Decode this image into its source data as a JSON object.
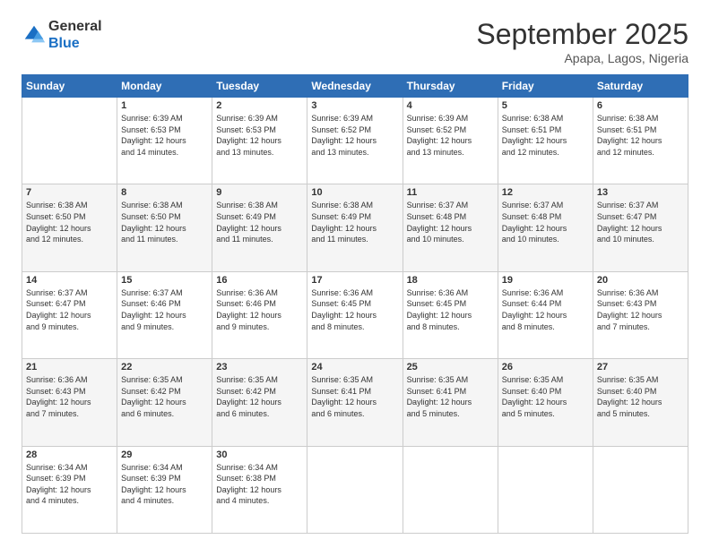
{
  "header": {
    "logo_general": "General",
    "logo_blue": "Blue",
    "month": "September 2025",
    "location": "Apapa, Lagos, Nigeria"
  },
  "days_of_week": [
    "Sunday",
    "Monday",
    "Tuesday",
    "Wednesday",
    "Thursday",
    "Friday",
    "Saturday"
  ],
  "weeks": [
    [
      {
        "day": "",
        "info": ""
      },
      {
        "day": "1",
        "info": "Sunrise: 6:39 AM\nSunset: 6:53 PM\nDaylight: 12 hours\nand 14 minutes."
      },
      {
        "day": "2",
        "info": "Sunrise: 6:39 AM\nSunset: 6:53 PM\nDaylight: 12 hours\nand 13 minutes."
      },
      {
        "day": "3",
        "info": "Sunrise: 6:39 AM\nSunset: 6:52 PM\nDaylight: 12 hours\nand 13 minutes."
      },
      {
        "day": "4",
        "info": "Sunrise: 6:39 AM\nSunset: 6:52 PM\nDaylight: 12 hours\nand 13 minutes."
      },
      {
        "day": "5",
        "info": "Sunrise: 6:38 AM\nSunset: 6:51 PM\nDaylight: 12 hours\nand 12 minutes."
      },
      {
        "day": "6",
        "info": "Sunrise: 6:38 AM\nSunset: 6:51 PM\nDaylight: 12 hours\nand 12 minutes."
      }
    ],
    [
      {
        "day": "7",
        "info": "Sunrise: 6:38 AM\nSunset: 6:50 PM\nDaylight: 12 hours\nand 12 minutes."
      },
      {
        "day": "8",
        "info": "Sunrise: 6:38 AM\nSunset: 6:50 PM\nDaylight: 12 hours\nand 11 minutes."
      },
      {
        "day": "9",
        "info": "Sunrise: 6:38 AM\nSunset: 6:49 PM\nDaylight: 12 hours\nand 11 minutes."
      },
      {
        "day": "10",
        "info": "Sunrise: 6:38 AM\nSunset: 6:49 PM\nDaylight: 12 hours\nand 11 minutes."
      },
      {
        "day": "11",
        "info": "Sunrise: 6:37 AM\nSunset: 6:48 PM\nDaylight: 12 hours\nand 10 minutes."
      },
      {
        "day": "12",
        "info": "Sunrise: 6:37 AM\nSunset: 6:48 PM\nDaylight: 12 hours\nand 10 minutes."
      },
      {
        "day": "13",
        "info": "Sunrise: 6:37 AM\nSunset: 6:47 PM\nDaylight: 12 hours\nand 10 minutes."
      }
    ],
    [
      {
        "day": "14",
        "info": "Sunrise: 6:37 AM\nSunset: 6:47 PM\nDaylight: 12 hours\nand 9 minutes."
      },
      {
        "day": "15",
        "info": "Sunrise: 6:37 AM\nSunset: 6:46 PM\nDaylight: 12 hours\nand 9 minutes."
      },
      {
        "day": "16",
        "info": "Sunrise: 6:36 AM\nSunset: 6:46 PM\nDaylight: 12 hours\nand 9 minutes."
      },
      {
        "day": "17",
        "info": "Sunrise: 6:36 AM\nSunset: 6:45 PM\nDaylight: 12 hours\nand 8 minutes."
      },
      {
        "day": "18",
        "info": "Sunrise: 6:36 AM\nSunset: 6:45 PM\nDaylight: 12 hours\nand 8 minutes."
      },
      {
        "day": "19",
        "info": "Sunrise: 6:36 AM\nSunset: 6:44 PM\nDaylight: 12 hours\nand 8 minutes."
      },
      {
        "day": "20",
        "info": "Sunrise: 6:36 AM\nSunset: 6:43 PM\nDaylight: 12 hours\nand 7 minutes."
      }
    ],
    [
      {
        "day": "21",
        "info": "Sunrise: 6:36 AM\nSunset: 6:43 PM\nDaylight: 12 hours\nand 7 minutes."
      },
      {
        "day": "22",
        "info": "Sunrise: 6:35 AM\nSunset: 6:42 PM\nDaylight: 12 hours\nand 6 minutes."
      },
      {
        "day": "23",
        "info": "Sunrise: 6:35 AM\nSunset: 6:42 PM\nDaylight: 12 hours\nand 6 minutes."
      },
      {
        "day": "24",
        "info": "Sunrise: 6:35 AM\nSunset: 6:41 PM\nDaylight: 12 hours\nand 6 minutes."
      },
      {
        "day": "25",
        "info": "Sunrise: 6:35 AM\nSunset: 6:41 PM\nDaylight: 12 hours\nand 5 minutes."
      },
      {
        "day": "26",
        "info": "Sunrise: 6:35 AM\nSunset: 6:40 PM\nDaylight: 12 hours\nand 5 minutes."
      },
      {
        "day": "27",
        "info": "Sunrise: 6:35 AM\nSunset: 6:40 PM\nDaylight: 12 hours\nand 5 minutes."
      }
    ],
    [
      {
        "day": "28",
        "info": "Sunrise: 6:34 AM\nSunset: 6:39 PM\nDaylight: 12 hours\nand 4 minutes."
      },
      {
        "day": "29",
        "info": "Sunrise: 6:34 AM\nSunset: 6:39 PM\nDaylight: 12 hours\nand 4 minutes."
      },
      {
        "day": "30",
        "info": "Sunrise: 6:34 AM\nSunset: 6:38 PM\nDaylight: 12 hours\nand 4 minutes."
      },
      {
        "day": "",
        "info": ""
      },
      {
        "day": "",
        "info": ""
      },
      {
        "day": "",
        "info": ""
      },
      {
        "day": "",
        "info": ""
      }
    ]
  ]
}
